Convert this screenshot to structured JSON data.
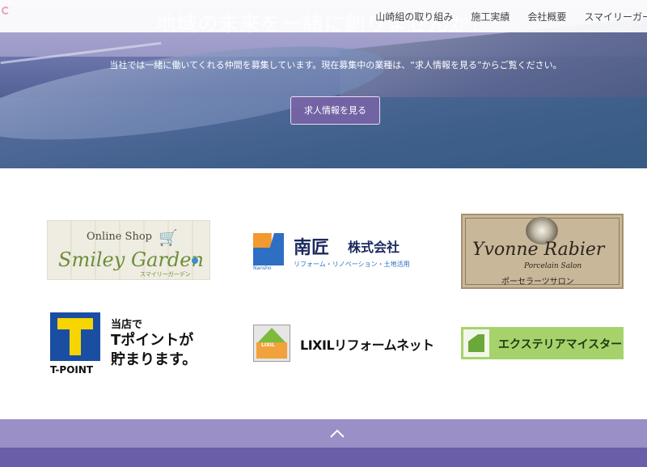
{
  "nav": {
    "items": [
      "山崎組の取り組み",
      "施工実績",
      "会社概要",
      "スマイリーガー"
    ]
  },
  "hero": {
    "title": "地域の未来を一緒に創りませんか？",
    "text": "当社では一緒に働いてくれる仲間を募集しています。現在募集中の業種は、“求人情報を見る”からご覧ください。",
    "button": "求人情報を見る"
  },
  "partners": {
    "smiley": {
      "shop": "Online Shop",
      "name": "Smiley Garden",
      "sub": "スマイリーガーデン",
      "icon": "shopping-cart-icon"
    },
    "nansho": {
      "mark_label": "Nansho",
      "name": "南匠",
      "corp": "株式会社",
      "desc": "リフォーム・リノベーション・土地活用"
    },
    "yvonne": {
      "brand": "Yvonne Rabier",
      "salon": "Porcelain Salon",
      "jp": "ポーセラーツサロン"
    },
    "tpoint": {
      "label": "T-POINT",
      "line1": "当店で",
      "line2": "Tポイントが",
      "line3": "貯まります。"
    },
    "lixil": {
      "icon_text": "LIXIL",
      "name": "LIXILリフォームネット"
    },
    "exterior": {
      "name": "エクステリアマイスター"
    }
  },
  "footer": {
    "scroll_icon": "chevron-up-icon"
  },
  "colors": {
    "accent": "#7663a6",
    "footer_light": "#9a8fc6",
    "footer_dark": "#6b5ea8"
  }
}
